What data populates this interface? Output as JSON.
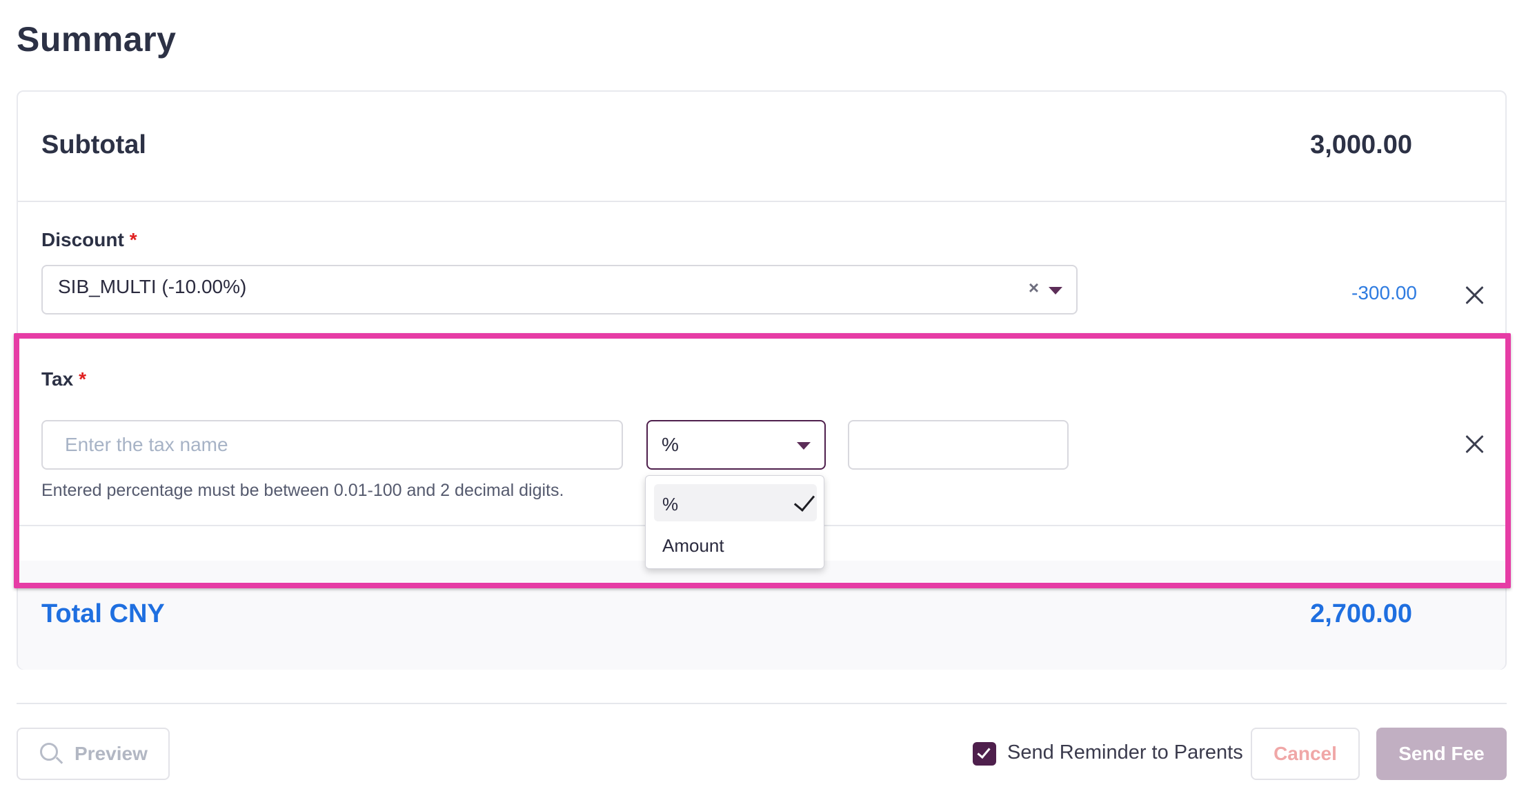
{
  "page": {
    "title": "Summary"
  },
  "subtotal": {
    "label": "Subtotal",
    "value": "3,000.00"
  },
  "discount": {
    "label": "Discount",
    "required_mark": "*",
    "selected_value": "SIB_MULTI (-10.00%)",
    "clear_icon": "×",
    "amount": "-300.00"
  },
  "tax": {
    "label": "Tax",
    "required_mark": "*",
    "name_placeholder": "Enter the tax name",
    "name_value": "",
    "type_selected": "%",
    "value_input": "",
    "help_text": "Entered percentage must be between 0.01-100 and 2 decimal digits.",
    "type_options": [
      {
        "label": "%",
        "selected": true
      },
      {
        "label": "Amount",
        "selected": false
      }
    ]
  },
  "total": {
    "label": "Total CNY",
    "value": "2,700.00"
  },
  "footer": {
    "preview_label": "Preview",
    "reminder_label": "Send Reminder to Parents",
    "reminder_checked": true,
    "cancel_label": "Cancel",
    "send_label": "Send Fee"
  },
  "colors": {
    "accent_purple": "#4e1f4c",
    "link_blue": "#1f6fe0",
    "highlight_pink": "#e63ca5",
    "required_red": "#e02020"
  }
}
